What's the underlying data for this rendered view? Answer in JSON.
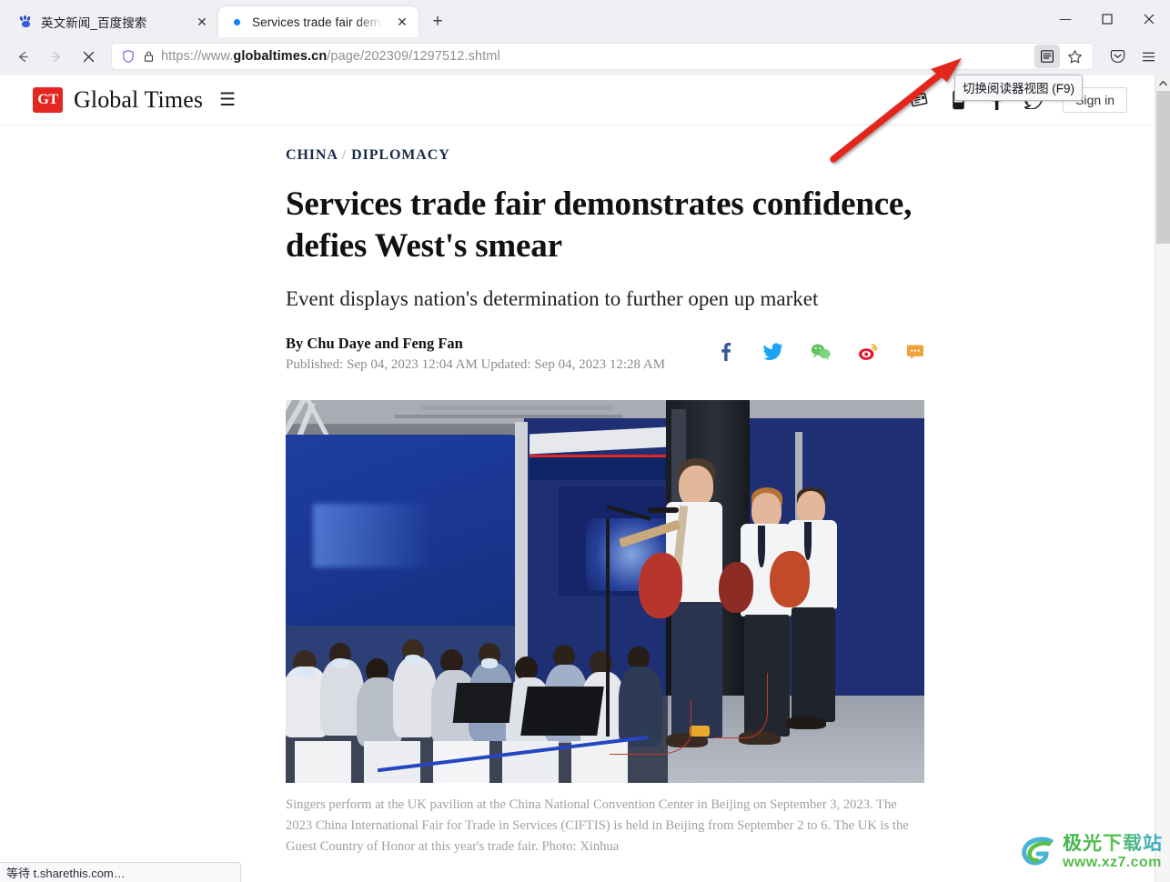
{
  "browser": {
    "tabs": [
      {
        "title": "英文新闻_百度搜索",
        "favicon": "baidu-icon",
        "active": false,
        "close_label": "✕"
      },
      {
        "title": "Services trade fair demonstra",
        "favicon": "loading-indicator",
        "active": true,
        "close_label": "✕"
      }
    ],
    "newtab_label": "+",
    "window_controls": {
      "minimize": "—",
      "maximize": "☐",
      "close": "✕"
    },
    "nav": {
      "back_label": "←",
      "forward_label": "→",
      "stop_label": "✕",
      "url_prefix": "https://www.",
      "url_domain": "globaltimes.cn",
      "url_path": "/page/202309/1297512.shtml",
      "shield_icon": "shield-icon",
      "lock_icon": "lock-icon",
      "reader_view_icon": "reader-view-icon",
      "bookmark_icon": "star-icon",
      "pocket_icon": "pocket-icon",
      "menu_icon": "hamburger-menu-icon"
    },
    "tooltip": "切换阅读器视图 (F9)",
    "statusbar": "等待 t.sharethis.com…",
    "accent_color": "#0a84ff"
  },
  "site": {
    "logo_badge": "GT",
    "logo_name": "Global Times",
    "menu_icon": "hamburger-icon",
    "header_icons": [
      "newspaper-icon",
      "mobile-icon",
      "facebook-icon",
      "twitter-icon"
    ],
    "signin_label": "Sign in",
    "brand_red": "#e3261f"
  },
  "article": {
    "kicker_primary": "CHINA",
    "kicker_separator": "/",
    "kicker_secondary": "DIPLOMACY",
    "headline": "Services trade fair demonstrates confidence, defies West's smear",
    "subheadline": "Event displays nation's determination to further open up market",
    "byline": "By Chu Daye and Feng Fan",
    "published_updated": "Published: Sep 04, 2023 12:04 AM Updated: Sep 04, 2023 12:28 AM",
    "share_icons": [
      "facebook-icon",
      "twitter-icon",
      "wechat-icon",
      "weibo-icon",
      "message-icon"
    ],
    "photo_alt": "Singers perform at the UK pavilion with a band on stage before a crowd",
    "caption": "Singers perform at the UK pavilion at the China National Convention Center in Beijing on September 3, 2023. The 2023 China International Fair for Trade in Services (CIFTIS) is held in Beijing from September 2 to 6. The UK is the Guest Country of Honor at this year's trade fair. Photo: Xinhua"
  },
  "watermark": {
    "title": "极光下载站",
    "url": "www.xz7.com"
  }
}
